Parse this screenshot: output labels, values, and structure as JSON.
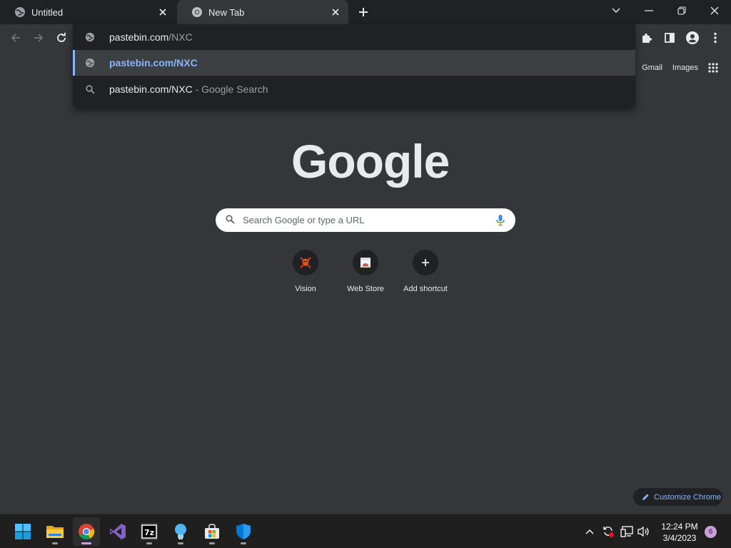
{
  "tabs": [
    {
      "title": "Untitled",
      "icon": "globe-icon"
    },
    {
      "title": "New Tab",
      "icon": "chrome-icon"
    }
  ],
  "omnibox": {
    "typed": "pastebin.com",
    "completion": "/NXC",
    "suggestions": [
      {
        "text": "pastebin.com/NXC",
        "icon": "globe-icon"
      },
      {
        "text": "pastebin.com/NXC",
        "suffix": " - Google Search",
        "icon": "search-icon"
      }
    ]
  },
  "ntp": {
    "links": {
      "gmail": "Gmail",
      "images": "Images"
    },
    "logo": "Google",
    "search_placeholder": "Search Google or type a URL",
    "shortcuts": [
      {
        "label": "Vision",
        "icon": "skull-crossbones-icon"
      },
      {
        "label": "Web Store",
        "icon": "web-store-icon"
      },
      {
        "label": "Add shortcut",
        "icon": "plus-icon"
      }
    ],
    "customize_label": "Customize Chrome"
  },
  "taskbar": {
    "apps": [
      "windows-start-icon",
      "file-explorer-icon",
      "chrome-icon",
      "visual-studio-icon",
      "7zip-icon",
      "tips-bulb-icon",
      "microsoft-store-icon",
      "windows-security-icon"
    ],
    "time": "12:24 PM",
    "date": "3/4/2023",
    "notification_count": "6"
  },
  "colors": {
    "tab_strip": "#202124",
    "toolbar": "#35363a",
    "accent": "#8ab4f8"
  }
}
